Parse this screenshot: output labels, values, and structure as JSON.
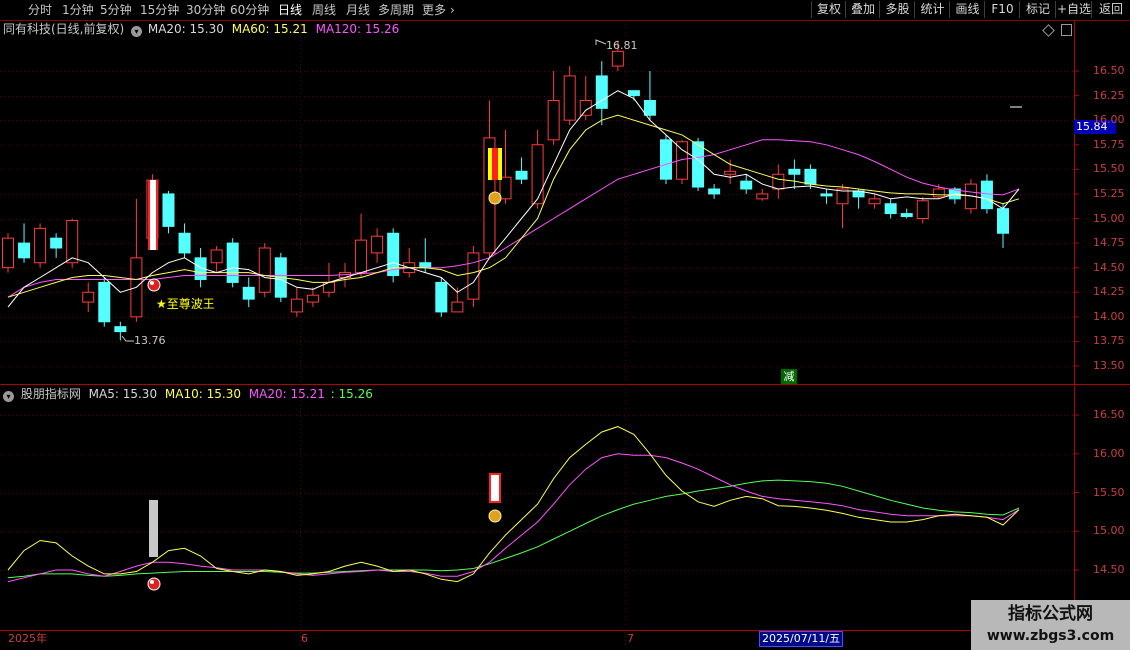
{
  "toolbar": {
    "periods": [
      "分时",
      "1分钟",
      "5分钟",
      "15分钟",
      "30分钟",
      "60分钟",
      "日线",
      "周线",
      "月线",
      "多周期",
      "更多"
    ],
    "active_period": "日线",
    "more_icon": "chevron-right",
    "right_buttons": [
      "复权",
      "叠加",
      "多股",
      "统计",
      "画线",
      "F10",
      "标记",
      "+自选",
      "返回"
    ]
  },
  "main_chart": {
    "title": "同有科技(日线,前复权)",
    "menu_icon": "chevron-down-circle",
    "ma20_label": "MA20: 15.30",
    "ma60_label": "MA60: 15.21",
    "ma120_label": "MA120: 15.26",
    "high_label": "16.81",
    "low_label": "13.76",
    "signal_text": "★至尊波王",
    "event_tag": "减",
    "current_price": "15.84",
    "y_ticks": [
      "16.50",
      "16.25",
      "16.00",
      "15.75",
      "15.50",
      "15.25",
      "15.00",
      "14.75",
      "14.50",
      "14.25",
      "14.00",
      "13.75",
      "13.50"
    ],
    "colors": {
      "up": "#ff3c3c",
      "down": "#54ffff",
      "ma20": "#ffffff",
      "ma60": "#ffff54",
      "ma120": "#ff54ff",
      "signal": "#ffff00"
    }
  },
  "sub_chart": {
    "title": "股朋指标网",
    "ma5_label": "MA5: 15.30",
    "ma10_label": "MA10: 15.30",
    "ma20_label": "MA20: 15.21",
    "extra_label": ": 15.26",
    "y_ticks": [
      "16.50",
      "16.00",
      "15.50",
      "15.00",
      "14.50"
    ],
    "colors": {
      "ma5": "#ffff54",
      "ma10": "#ff54ff",
      "ma20": "#54ff54",
      "extra": "#54ff54"
    }
  },
  "x_axis": {
    "labels": [
      "2025年",
      "6",
      "7"
    ],
    "cursor_date": "2025/07/11/五"
  },
  "watermark": {
    "line1": "指标公式网",
    "line2": "www.zbgs3.com"
  },
  "chart_data": {
    "type": "candlestick",
    "candles": [
      [
        14.5,
        14.8,
        14.85,
        14.45
      ],
      [
        14.75,
        14.6,
        14.95,
        14.55
      ],
      [
        14.55,
        14.9,
        14.95,
        14.5
      ],
      [
        14.8,
        14.7,
        14.85,
        14.6
      ],
      [
        14.55,
        14.98,
        15.0,
        14.5
      ],
      [
        14.15,
        14.25,
        14.35,
        14.05
      ],
      [
        14.35,
        13.95,
        14.4,
        13.9
      ],
      [
        13.9,
        13.85,
        13.95,
        13.76
      ],
      [
        14.0,
        14.6,
        15.2,
        13.95
      ],
      [
        14.8,
        15.39,
        15.45,
        14.7
      ],
      [
        15.25,
        14.92,
        15.28,
        14.85
      ],
      [
        14.85,
        14.65,
        14.95,
        14.6
      ],
      [
        14.6,
        14.38,
        14.7,
        14.3
      ],
      [
        14.55,
        14.68,
        14.72,
        14.45
      ],
      [
        14.75,
        14.35,
        14.8,
        14.3
      ],
      [
        14.3,
        14.18,
        14.4,
        14.1
      ],
      [
        14.25,
        14.7,
        14.75,
        14.2
      ],
      [
        14.6,
        14.2,
        14.65,
        14.15
      ],
      [
        14.05,
        14.18,
        14.3,
        14.0
      ],
      [
        14.15,
        14.22,
        14.3,
        14.1
      ],
      [
        14.25,
        14.35,
        14.55,
        14.2
      ],
      [
        14.4,
        14.45,
        14.55,
        14.3
      ],
      [
        14.45,
        14.78,
        15.05,
        14.4
      ],
      [
        14.65,
        14.82,
        14.9,
        14.55
      ],
      [
        14.85,
        14.42,
        14.9,
        14.35
      ],
      [
        14.45,
        14.55,
        14.7,
        14.4
      ],
      [
        14.55,
        14.5,
        14.8,
        14.45
      ],
      [
        14.35,
        14.05,
        14.4,
        14.0
      ],
      [
        14.05,
        14.15,
        14.3,
        14.05
      ],
      [
        14.18,
        14.65,
        14.72,
        14.1
      ],
      [
        14.65,
        15.82,
        16.2,
        14.6
      ],
      [
        15.2,
        15.42,
        15.9,
        15.15
      ],
      [
        15.48,
        15.4,
        15.62,
        15.35
      ],
      [
        15.15,
        15.75,
        15.9,
        15.1
      ],
      [
        15.8,
        16.2,
        16.5,
        15.75
      ],
      [
        16.0,
        16.45,
        16.55,
        15.95
      ],
      [
        16.05,
        16.2,
        16.45,
        16.0
      ],
      [
        16.45,
        16.12,
        16.6,
        15.95
      ],
      [
        16.55,
        16.7,
        16.81,
        16.5
      ],
      [
        16.3,
        16.25,
        16.3,
        16.2
      ],
      [
        16.2,
        16.05,
        16.5,
        16.0
      ],
      [
        15.8,
        15.4,
        15.85,
        15.35
      ],
      [
        15.4,
        15.78,
        15.8,
        15.35
      ],
      [
        15.78,
        15.32,
        15.82,
        15.28
      ],
      [
        15.3,
        15.25,
        15.35,
        15.2
      ],
      [
        15.45,
        15.48,
        15.6,
        15.35
      ],
      [
        15.38,
        15.3,
        15.45,
        15.25
      ],
      [
        15.2,
        15.25,
        15.3,
        15.18
      ],
      [
        15.3,
        15.45,
        15.55,
        15.2
      ],
      [
        15.5,
        15.45,
        15.6,
        15.3
      ],
      [
        15.5,
        15.35,
        15.55,
        15.3
      ],
      [
        15.25,
        15.23,
        15.3,
        15.15
      ],
      [
        15.15,
        15.3,
        15.35,
        14.9
      ],
      [
        15.28,
        15.22,
        15.3,
        15.1
      ],
      [
        15.15,
        15.2,
        15.25,
        15.1
      ],
      [
        15.15,
        15.05,
        15.2,
        15.0
      ],
      [
        15.05,
        15.02,
        15.1,
        15.0
      ],
      [
        15.0,
        15.18,
        15.22,
        14.95
      ],
      [
        15.22,
        15.3,
        15.35,
        15.2
      ],
      [
        15.3,
        15.2,
        15.32,
        15.15
      ],
      [
        15.1,
        15.35,
        15.4,
        15.05
      ],
      [
        15.38,
        15.1,
        15.45,
        15.05
      ],
      [
        15.1,
        14.85,
        15.15,
        14.7
      ]
    ],
    "ma20": [
      14.1,
      14.3,
      14.4,
      14.5,
      14.6,
      14.55,
      14.4,
      14.25,
      14.3,
      14.45,
      14.55,
      14.6,
      14.5,
      14.45,
      14.5,
      14.48,
      14.4,
      14.38,
      14.3,
      14.28,
      14.35,
      14.4,
      14.45,
      14.5,
      14.55,
      14.5,
      14.45,
      14.4,
      14.25,
      14.35,
      14.6,
      14.8,
      15.0,
      15.2,
      15.55,
      15.9,
      16.1,
      16.2,
      16.3,
      16.22,
      16.0,
      15.85,
      15.7,
      15.6,
      15.45,
      15.42,
      15.45,
      15.35,
      15.3,
      15.32,
      15.33,
      15.3,
      15.28,
      15.28,
      15.25,
      15.2,
      15.22,
      15.2,
      15.2,
      15.25,
      15.23,
      15.2,
      15.1,
      15.3
    ],
    "ma60": [
      14.2,
      14.25,
      14.3,
      14.35,
      14.4,
      14.42,
      14.42,
      14.4,
      14.38,
      14.42,
      14.45,
      14.48,
      14.45,
      14.45,
      14.45,
      14.45,
      14.42,
      14.4,
      14.38,
      14.35,
      14.35,
      14.38,
      14.4,
      14.45,
      14.5,
      14.5,
      14.5,
      14.48,
      14.42,
      14.45,
      14.5,
      14.6,
      14.8,
      15.0,
      15.4,
      15.7,
      15.9,
      16.0,
      16.05,
      16.0,
      15.95,
      15.9,
      15.85,
      15.75,
      15.65,
      15.55,
      15.5,
      15.45,
      15.4,
      15.38,
      15.35,
      15.33,
      15.32,
      15.3,
      15.28,
      15.26,
      15.25,
      15.25,
      15.24,
      15.24,
      15.23,
      15.2,
      15.15,
      15.2
    ],
    "ma120": [
      14.2,
      14.3,
      14.35,
      14.38,
      14.38,
      14.38,
      14.38,
      14.38,
      14.38,
      14.38,
      14.4,
      14.42,
      14.42,
      14.42,
      14.42,
      14.42,
      14.42,
      14.42,
      14.42,
      14.42,
      14.42,
      14.43,
      14.44,
      14.45,
      14.48,
      14.5,
      14.5,
      14.5,
      14.52,
      14.55,
      14.6,
      14.7,
      14.8,
      14.9,
      15.0,
      15.1,
      15.2,
      15.3,
      15.4,
      15.45,
      15.5,
      15.55,
      15.6,
      15.62,
      15.65,
      15.7,
      15.75,
      15.8,
      15.8,
      15.79,
      15.78,
      15.75,
      15.7,
      15.65,
      15.58,
      15.5,
      15.42,
      15.36,
      15.32,
      15.29,
      15.27,
      15.25,
      15.24,
      15.3
    ],
    "sub_ma5": [
      14.5,
      14.75,
      14.88,
      14.85,
      14.68,
      14.55,
      14.45,
      14.45,
      14.48,
      14.6,
      14.75,
      14.78,
      14.68,
      14.52,
      14.48,
      14.45,
      14.5,
      14.48,
      14.43,
      14.45,
      14.48,
      14.55,
      14.6,
      14.55,
      14.48,
      14.5,
      14.45,
      14.38,
      14.35,
      14.45,
      14.72,
      14.95,
      15.15,
      15.35,
      15.68,
      15.95,
      16.12,
      16.28,
      16.35,
      16.25,
      16.0,
      15.72,
      15.52,
      15.38,
      15.32,
      15.4,
      15.45,
      15.42,
      15.33,
      15.32,
      15.3,
      15.27,
      15.23,
      15.18,
      15.15,
      15.12,
      15.12,
      15.15,
      15.2,
      15.22,
      15.2,
      15.18,
      15.08,
      15.28
    ],
    "sub_ma10": [
      14.35,
      14.4,
      14.45,
      14.5,
      14.5,
      14.45,
      14.42,
      14.48,
      14.55,
      14.6,
      14.6,
      14.58,
      14.55,
      14.53,
      14.5,
      14.5,
      14.5,
      14.48,
      14.45,
      14.43,
      14.45,
      14.47,
      14.48,
      14.5,
      14.48,
      14.48,
      14.46,
      14.42,
      14.42,
      14.48,
      14.6,
      14.78,
      14.95,
      15.12,
      15.35,
      15.6,
      15.8,
      15.95,
      16.0,
      15.98,
      15.98,
      15.95,
      15.88,
      15.8,
      15.7,
      15.6,
      15.52,
      15.45,
      15.42,
      15.4,
      15.38,
      15.36,
      15.33,
      15.28,
      15.25,
      15.22,
      15.2,
      15.2,
      15.2,
      15.2,
      15.2,
      15.18,
      15.15,
      15.28
    ],
    "sub_ma20": [
      14.4,
      14.42,
      14.45,
      14.45,
      14.45,
      14.43,
      14.42,
      14.43,
      14.45,
      14.46,
      14.47,
      14.48,
      14.48,
      14.48,
      14.48,
      14.48,
      14.48,
      14.47,
      14.46,
      14.46,
      14.47,
      14.48,
      14.49,
      14.5,
      14.5,
      14.5,
      14.5,
      14.49,
      14.5,
      14.52,
      14.58,
      14.65,
      14.72,
      14.8,
      14.9,
      15.0,
      15.1,
      15.2,
      15.28,
      15.35,
      15.4,
      15.45,
      15.48,
      15.52,
      15.55,
      15.58,
      15.62,
      15.65,
      15.66,
      15.65,
      15.64,
      15.62,
      15.58,
      15.52,
      15.46,
      15.4,
      15.35,
      15.3,
      15.27,
      15.25,
      15.24,
      15.22,
      15.21,
      15.3
    ]
  }
}
